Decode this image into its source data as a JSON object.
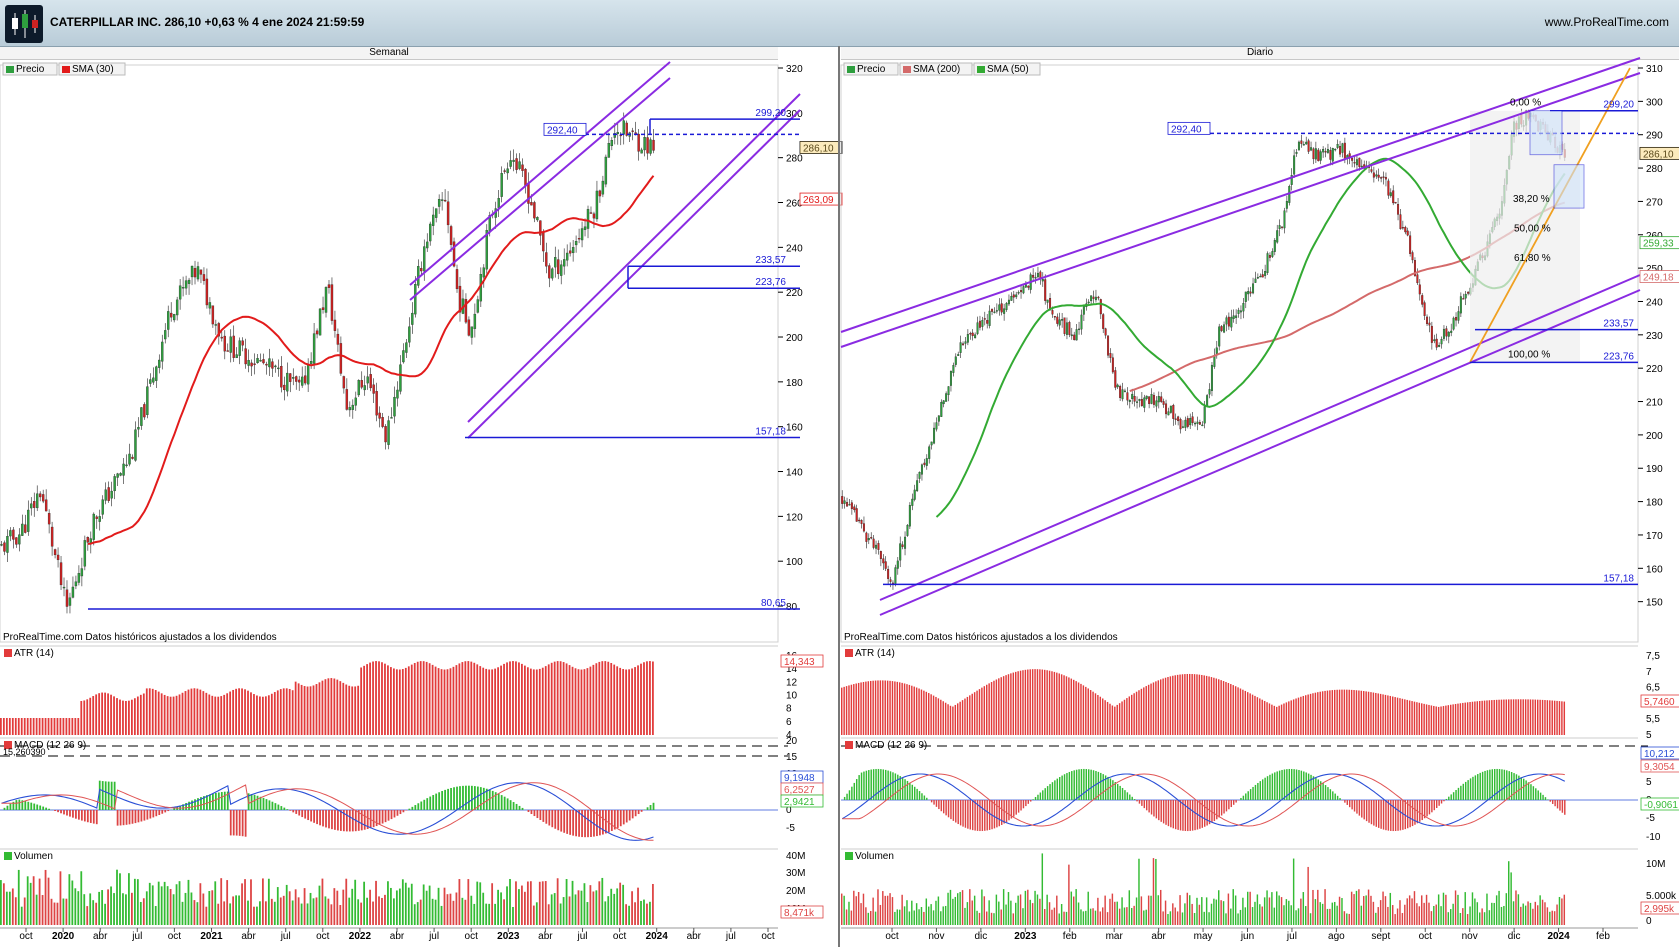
{
  "header": {
    "title": "CATERPILLAR INC. 286,10 +0,63 % 4 ene 2024 21:59:59",
    "site": "www.ProRealTime.com"
  },
  "colors": {
    "price_up": "#2e9e3e",
    "price_down": "#cc2222",
    "sma30": "#e21b1b",
    "sma200": "#d46a6a",
    "sma50": "#33aa33",
    "channel": "#8a2be2",
    "level": "#1a1ad6",
    "atr": "#e23b3b",
    "macd": "#2a4fd6",
    "signal": "#e05555",
    "volume_up": "#33bb33",
    "volume_down": "#dd4444",
    "trendline": "#f0a020"
  },
  "weekly": {
    "panel_title": "Semanal",
    "price_legend": [
      "Precio",
      "SMA (30)"
    ],
    "price_axis": [
      "320",
      "300",
      "280",
      "260",
      "240",
      "220",
      "200",
      "180",
      "160",
      "140",
      "120",
      "100",
      "80"
    ],
    "levels": [
      "299,20",
      "292,40",
      "233,57",
      "223,76",
      "157,18",
      "80,65"
    ],
    "last_price": "286,10",
    "sma_value": "263,09",
    "footer": "ProRealTime.com  Datos históricos ajustados a los dividendos",
    "atr_legend": "ATR (14)",
    "atr_axis": [
      "16",
      "14",
      "12",
      "10",
      "8",
      "6",
      "4"
    ],
    "atr_value": "14,343",
    "macd_legend": "MACD (12 26 9)",
    "macd_axis": [
      "20",
      "15",
      "10",
      "5",
      "0",
      "-5"
    ],
    "macd_values": [
      "9,1948",
      "6,2527",
      "2,9421"
    ],
    "macd_hidden_value": "15,260390",
    "volume_legend": "Volumen",
    "volume_axis": [
      "40M",
      "30M",
      "20M",
      "10M"
    ],
    "volume_value": "8,471k",
    "time_axis": [
      "oct",
      "2020",
      "abr",
      "jul",
      "oct",
      "2021",
      "abr",
      "jul",
      "oct",
      "2022",
      "abr",
      "jul",
      "oct",
      "2023",
      "abr",
      "jul",
      "oct",
      "2024",
      "abr",
      "jul",
      "oct"
    ]
  },
  "daily": {
    "panel_title": "Diario",
    "price_legend": [
      "Precio",
      "SMA (200)",
      "SMA (50)"
    ],
    "price_axis": [
      "310",
      "300",
      "290",
      "280",
      "270",
      "260",
      "250",
      "240",
      "230",
      "220",
      "210",
      "200",
      "190",
      "180",
      "170",
      "160",
      "150"
    ],
    "levels": [
      "299,20",
      "292,40",
      "233,57",
      "223,76",
      "157,18"
    ],
    "fib": [
      "0,00 %",
      "38,20 %",
      "50,00 %",
      "61,80 %",
      "100,00 %"
    ],
    "last_price": "286,10",
    "sma50_value": "259,33",
    "sma200_value": "249,18",
    "footer": "ProRealTime.com  Datos históricos ajustados a los dividendos",
    "atr_legend": "ATR (14)",
    "atr_axis": [
      "7,5",
      "7",
      "6,5",
      "6",
      "5,5",
      "5"
    ],
    "atr_value": "5,7460",
    "macd_legend": "MACD (12 26 9)",
    "macd_axis": [
      "5",
      "0",
      "-5",
      "-10"
    ],
    "macd_values": [
      "10,212",
      "9,3054",
      "-0,9061"
    ],
    "volume_legend": "Volumen",
    "volume_axis": [
      "10M",
      "5.000k",
      "0"
    ],
    "volume_value": "2,995k",
    "time_axis": [
      "oct",
      "nov",
      "dic",
      "2023",
      "feb",
      "mar",
      "abr",
      "may",
      "jun",
      "jul",
      "ago",
      "sept",
      "oct",
      "nov",
      "dic",
      "2024",
      "feb"
    ]
  }
}
